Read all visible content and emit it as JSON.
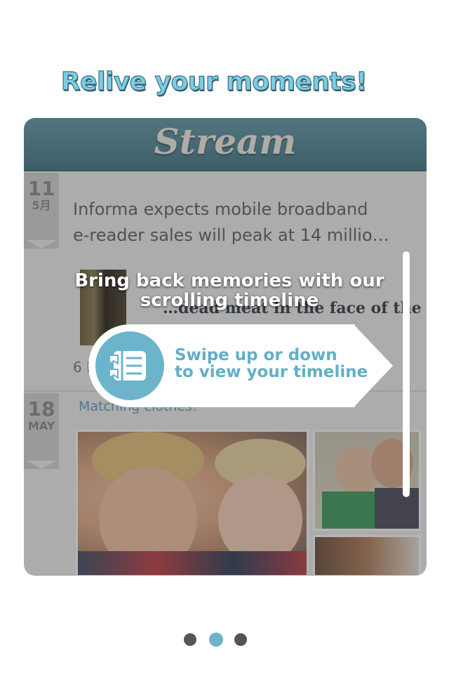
{
  "headline": "Relive your moments!",
  "card": {
    "title": "Stream",
    "entries": [
      {
        "day": "11",
        "month": "5月",
        "text_lines": [
          "Informa expects mobile broadband",
          "e-reader sales will peak at 14 millio…"
        ],
        "news_headline_lines": [
          "…dead meat in the face of the…"
        ],
        "count_prefix": "6 l"
      },
      {
        "day": "18",
        "month": "MAY",
        "caption": "Matching clothes!"
      }
    ]
  },
  "overlay": {
    "message_lines": [
      "Bring back memories with our",
      "scrolling timeline"
    ],
    "hint_lines": [
      "Swipe up or down",
      "to view your timeline"
    ],
    "hint_icon": "timeline-book-icon",
    "accent_color": "#6bb4cc"
  },
  "pagination": {
    "total": 3,
    "active_index": 1
  }
}
